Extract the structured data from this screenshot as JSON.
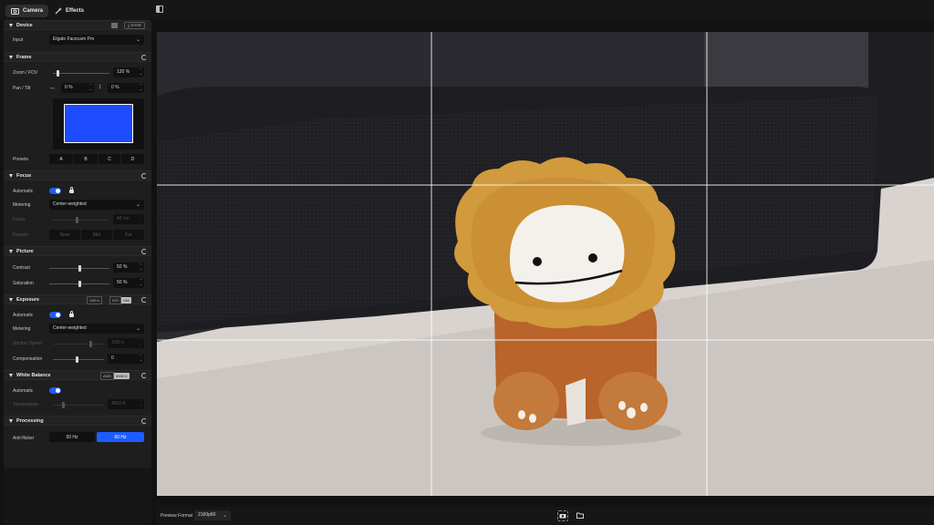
{
  "tabs": [
    {
      "label": "Camera"
    },
    {
      "label": "Effects"
    }
  ],
  "device": {
    "title": "Device",
    "save_label": "SAVE",
    "input_label": "Input",
    "input_value": "Elgato Facecam Pro"
  },
  "frame": {
    "title": "Frame",
    "zoom_label": "Zoom / FOV",
    "zoom_value": "120 %",
    "zoom_level": 0.1,
    "pan_tilt_label": "Pan / Tilt",
    "pan_value": "0 %",
    "tilt_value": "0 %",
    "presets_label": "Presets",
    "presets": [
      "A",
      "B",
      "C",
      "D"
    ]
  },
  "focus": {
    "title": "Focus",
    "automatic_label": "Automatic",
    "metering_label": "Metering",
    "metering_value": "Center-weighted",
    "focus_label": "Focus",
    "focus_value": "40 cm",
    "presets_label": "Presets",
    "presets": [
      "Near",
      "Mid",
      "Far"
    ]
  },
  "picture": {
    "title": "Picture",
    "contrast_label": "Contrast",
    "contrast_value": "50 %",
    "saturation_label": "Saturation",
    "saturation_value": "50 %"
  },
  "exposure": {
    "title": "Exposure",
    "shutter_badge": "1/60 s",
    "iso_key": "ISO",
    "iso_value": "248",
    "automatic_label": "Automatic",
    "metering_label": "Metering",
    "metering_value": "Center-weighted",
    "shutter_label": "Shutter Speed",
    "shutter_value": "1/60 s",
    "compensation_label": "Compensation",
    "compensation_value": "0"
  },
  "white_balance": {
    "title": "White Balance",
    "awb_key": "AWB",
    "awb_value": "6266 K",
    "automatic_label": "Automatic",
    "temperature_label": "Temperature",
    "temperature_value": "4500 K"
  },
  "processing": {
    "title": "Processing",
    "antiflicker_label": "Anti-flicker",
    "options": [
      "50 Hz",
      "60 Hz"
    ],
    "selected": "60 Hz"
  },
  "bottom": {
    "preview_format_label": "Preview Format",
    "preview_format_value": "2160p60"
  },
  "colors": {
    "accent": "#1d5cff",
    "sidebar_bg": "#1e1e1e",
    "app_bg": "#121212"
  }
}
